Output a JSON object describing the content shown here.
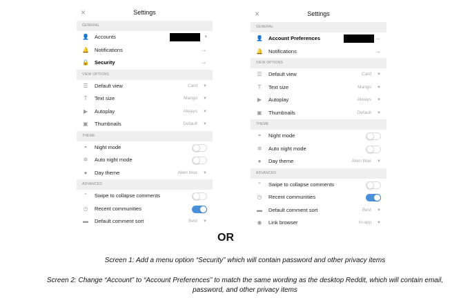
{
  "screen1": {
    "title": "Settings",
    "close_icon": "×",
    "sections": [
      {
        "label": "GENERAL",
        "rows": [
          {
            "icon": "👤",
            "label": "Accounts",
            "kind": "account"
          },
          {
            "icon": "🔔",
            "label": "Notifications",
            "kind": "arrow"
          },
          {
            "icon": "🔒",
            "label": "Security",
            "kind": "arrow",
            "bold": true
          }
        ]
      },
      {
        "label": "VIEW OPTIONS",
        "rows": [
          {
            "icon": "☰",
            "label": "Default view",
            "value": "Card",
            "kind": "select"
          },
          {
            "icon": "T",
            "label": "Text size",
            "value": "Mango",
            "kind": "select"
          },
          {
            "icon": "▶",
            "label": "Autoplay",
            "value": "Always",
            "kind": "select"
          },
          {
            "icon": "▣",
            "label": "Thumbnails",
            "value": "Default",
            "kind": "select"
          }
        ]
      },
      {
        "label": "THEME",
        "rows": [
          {
            "icon": "◓",
            "label": "Night mode",
            "kind": "toggle",
            "on": false
          },
          {
            "icon": "✲",
            "label": "Auto night mode",
            "kind": "toggle",
            "on": false
          },
          {
            "icon": "●",
            "label": "Day theme",
            "value": "Alien blue",
            "kind": "select"
          }
        ]
      },
      {
        "label": "ADVANCED",
        "rows": [
          {
            "icon": "⌃",
            "label": "Swipe to collapse comments",
            "kind": "toggle",
            "on": false
          },
          {
            "icon": "◷",
            "label": "Recent communities",
            "kind": "toggle",
            "on": true
          },
          {
            "icon": "▬",
            "label": "Default comment sort",
            "value": "Best",
            "kind": "select"
          }
        ]
      }
    ]
  },
  "screen2": {
    "title": "Settings",
    "close_icon": "×",
    "sections": [
      {
        "label": "GENERAL",
        "rows": [
          {
            "icon": "👤",
            "label": "Account Preferences",
            "kind": "account",
            "bold": true
          },
          {
            "icon": "🔔",
            "label": "Notifications",
            "kind": "arrow"
          }
        ]
      },
      {
        "label": "VIEW OPTIONS",
        "rows": [
          {
            "icon": "☰",
            "label": "Default view",
            "value": "Card",
            "kind": "select"
          },
          {
            "icon": "T",
            "label": "Text size",
            "value": "Mango",
            "kind": "select"
          },
          {
            "icon": "▶",
            "label": "Autoplay",
            "value": "Always",
            "kind": "select"
          },
          {
            "icon": "▣",
            "label": "Thumbnails",
            "value": "Default",
            "kind": "select"
          }
        ]
      },
      {
        "label": "THEME",
        "rows": [
          {
            "icon": "◓",
            "label": "Night mode",
            "kind": "toggle",
            "on": false
          },
          {
            "icon": "✲",
            "label": "Auto night mode",
            "kind": "toggle",
            "on": false
          },
          {
            "icon": "●",
            "label": "Day theme",
            "value": "Alien blue",
            "kind": "select"
          }
        ]
      },
      {
        "label": "ADVANCED",
        "rows": [
          {
            "icon": "⌃",
            "label": "Swipe to collapse comments",
            "kind": "toggle",
            "on": false
          },
          {
            "icon": "◷",
            "label": "Recent communities",
            "kind": "toggle",
            "on": true
          },
          {
            "icon": "▬",
            "label": "Default comment sort",
            "value": "Best",
            "kind": "select"
          },
          {
            "icon": "◉",
            "label": "Link browser",
            "value": "In-app",
            "kind": "select"
          }
        ]
      }
    ]
  },
  "or_label": "OR",
  "caption1": "Screen 1: Add a menu option “Security” which will contain password and other privacy items",
  "caption2": "Screen 2: Change “Account” to “Account Preferences” to match the same wording as the desktop Reddit, which will contain email, password, and other privacy items",
  "colors": {
    "toggle_on": "#4a90d9",
    "section_bg": "#efefef"
  }
}
